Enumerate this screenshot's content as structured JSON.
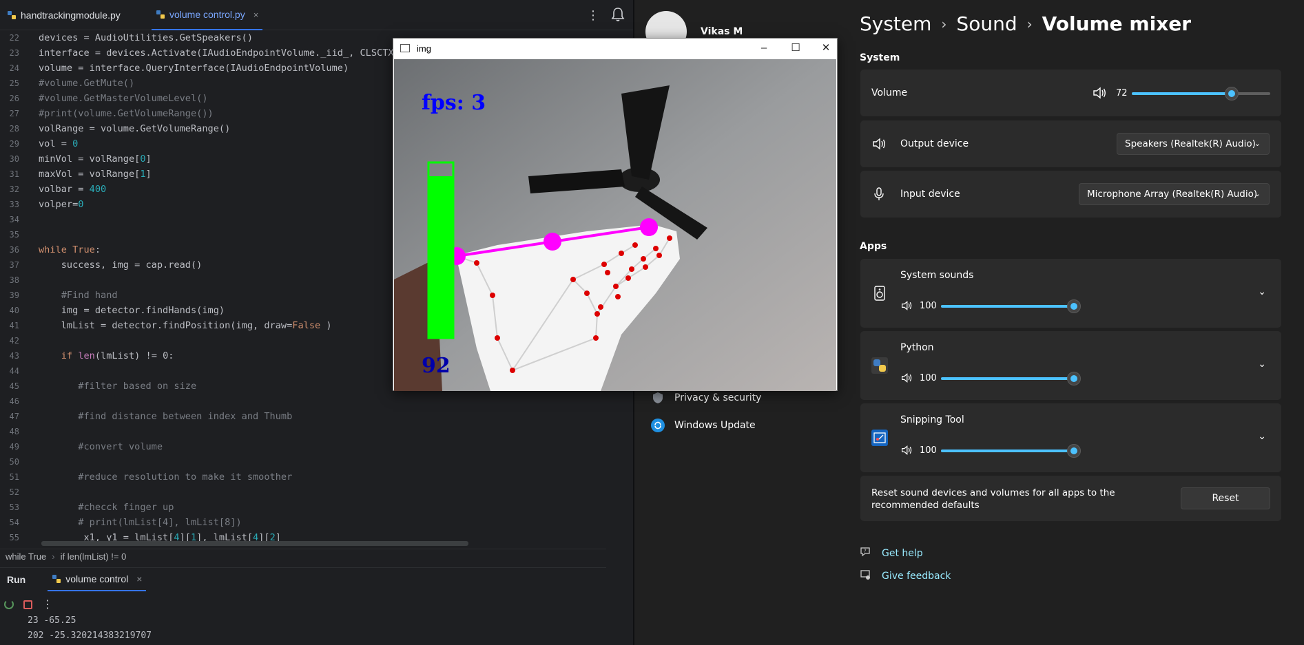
{
  "ide": {
    "tabs": [
      {
        "label": "handtrackingmodule.py"
      },
      {
        "label": "volume control.py",
        "close": "×"
      }
    ],
    "kebab": "⋮",
    "lines": [
      {
        "num": "22",
        "code": "devices = AudioUtilities.GetSpeakers()"
      },
      {
        "num": "23",
        "code": "interface = devices.Activate(IAudioEndpointVolume._iid_, CLSCTX_"
      },
      {
        "num": "24",
        "code": "volume = interface.QueryInterface(IAudioEndpointVolume)"
      },
      {
        "num": "25",
        "code": "#volume.GetMute()"
      },
      {
        "num": "26",
        "code": "#volume.GetMasterVolumeLevel()"
      },
      {
        "num": "27",
        "code": "#print(volume.GetVolumeRange())"
      },
      {
        "num": "28",
        "code": "volRange = volume.GetVolumeRange()"
      },
      {
        "num": "29",
        "code": "vol = 0"
      },
      {
        "num": "30",
        "code": "minVol = volRange[0]"
      },
      {
        "num": "31",
        "code": "maxVol = volRange[1]"
      },
      {
        "num": "32",
        "code": "volbar = 400"
      },
      {
        "num": "33",
        "code": "volper=0"
      },
      {
        "num": "34",
        "code": ""
      },
      {
        "num": "35",
        "code": ""
      },
      {
        "num": "36",
        "code": "while True:"
      },
      {
        "num": "37",
        "code": "    success, img = cap.read()"
      },
      {
        "num": "38",
        "code": ""
      },
      {
        "num": "39",
        "code": "    #Find hand"
      },
      {
        "num": "40",
        "code": "    img = detector.findHands(img)"
      },
      {
        "num": "41",
        "code": "    lmList = detector.findPosition(img, draw=False )"
      },
      {
        "num": "42",
        "code": ""
      },
      {
        "num": "43",
        "code": "    if len(lmList) != 0:"
      },
      {
        "num": "44",
        "code": ""
      },
      {
        "num": "45",
        "code": "       #filter based on size"
      },
      {
        "num": "46",
        "code": ""
      },
      {
        "num": "47",
        "code": "       #find distance between index and Thumb"
      },
      {
        "num": "48",
        "code": ""
      },
      {
        "num": "49",
        "code": "       #convert volume"
      },
      {
        "num": "50",
        "code": ""
      },
      {
        "num": "51",
        "code": "       #reduce resolution to make it smoother"
      },
      {
        "num": "52",
        "code": ""
      },
      {
        "num": "53",
        "code": "       #checck finger up"
      },
      {
        "num": "54",
        "code": "       # print(lmList[4], lmList[8])"
      },
      {
        "num": "55",
        "code": "        x1, y1 = lmList[4][1], lmList[4][2]"
      }
    ],
    "breadcrumb": [
      "while True",
      "if len(lmList) != 0"
    ],
    "run": {
      "title": "Run",
      "tab_label": "volume control",
      "close": "×",
      "kebab": "⋮",
      "output": [
        "23 -65.25",
        "202 -25.320214383219707"
      ]
    }
  },
  "settings": {
    "user_name": "Vikas M",
    "nav": [
      {
        "label": "Privacy & security",
        "icon": "shield-icon"
      },
      {
        "label": "Windows Update",
        "icon": "windows-update-icon"
      }
    ],
    "breadcrumb": {
      "part1": "System",
      "part2": "Sound",
      "current": "Volume mixer",
      "sep": "›"
    },
    "system_section": "System",
    "volume": {
      "label": "Volume",
      "value": "72",
      "level": 0.72
    },
    "output_device": {
      "label": "Output device",
      "value": "Speakers (Realtek(R) Audio)"
    },
    "input_device": {
      "label": "Input device",
      "value": "Microphone Array (Realtek(R) Audio)"
    },
    "apps_section": "Apps",
    "apps": [
      {
        "name": "System sounds",
        "value": "100",
        "level": 1.0,
        "icon": "speaker-app-icon"
      },
      {
        "name": "Python",
        "value": "100",
        "level": 1.0,
        "icon": "python-icon"
      },
      {
        "name": "Snipping Tool",
        "value": "100",
        "level": 1.0,
        "icon": "snipping-tool-icon"
      }
    ],
    "reset_text": "Reset sound devices and volumes for all apps to the recommended defaults",
    "reset_button": "Reset",
    "help": "Get help",
    "feedback": "Give feedback",
    "accent": "#4cc2ff"
  },
  "cv_window": {
    "title": "img",
    "fps_text": "fps: 3",
    "volume_percent_text": "92",
    "volume_bar_level": 0.92,
    "colors": {
      "bar": "#00ff00",
      "text": "#0000ff",
      "line": "#ff00ff",
      "landmarks": "#dd0000"
    }
  }
}
